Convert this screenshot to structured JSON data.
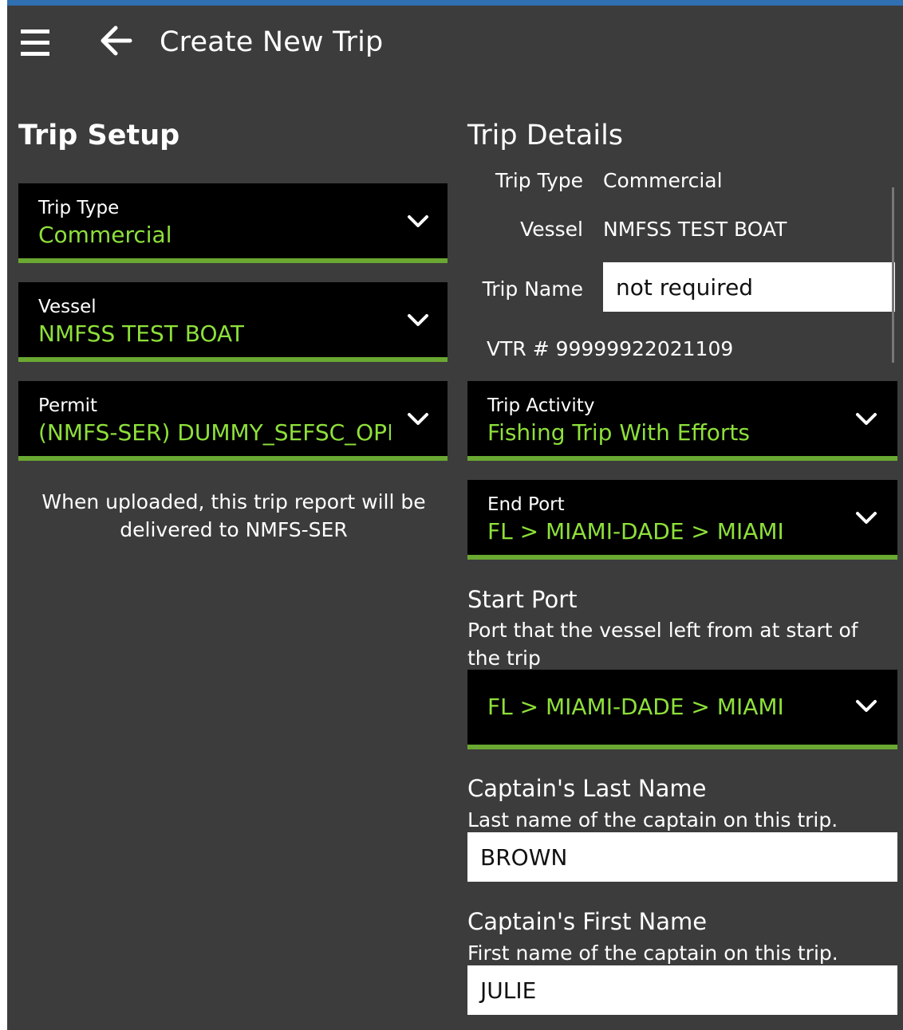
{
  "header": {
    "menu_icon": "hamburger-menu-icon",
    "back_icon": "arrow-left-icon",
    "title": "Create New Trip"
  },
  "trip_setup": {
    "heading": "Trip Setup",
    "trip_type": {
      "label": "Trip Type",
      "value": "Commercial"
    },
    "vessel": {
      "label": "Vessel",
      "value": "NMFSS TEST BOAT"
    },
    "permit": {
      "label": "Permit",
      "value": "(NMFS-SER) DUMMY_SEFSC_OPI"
    },
    "upload_note": "When uploaded, this trip report will be delivered to NMFS-SER"
  },
  "trip_details": {
    "heading": "Trip Details",
    "trip_type_label": "Trip Type",
    "trip_type_value": "Commercial",
    "vessel_label": "Vessel",
    "vessel_value": "NMFSS TEST BOAT",
    "trip_name_label": "Trip Name",
    "trip_name_value": "not required",
    "vtr": "VTR # 99999922021109",
    "trip_activity": {
      "label": "Trip Activity",
      "value": "Fishing Trip With Efforts"
    },
    "end_port": {
      "label": "End Port",
      "value": "FL > MIAMI-DADE > MIAMI"
    },
    "start_port": {
      "title": "Start Port",
      "description": "Port that the vessel left from at start of the trip",
      "value": "FL > MIAMI-DADE > MIAMI"
    },
    "captain_last": {
      "title": "Captain's Last Name",
      "description": "Last name of the captain on this trip.",
      "value": "BROWN"
    },
    "captain_first": {
      "title": "Captain's First Name",
      "description": "First name of the captain on this trip.",
      "value": "JULIE"
    }
  },
  "colors": {
    "background": "#3c3c3c",
    "accent_green": "#8ee03a",
    "underline_green": "#6aa832",
    "title_bar_blue": "#2f6fb2"
  }
}
